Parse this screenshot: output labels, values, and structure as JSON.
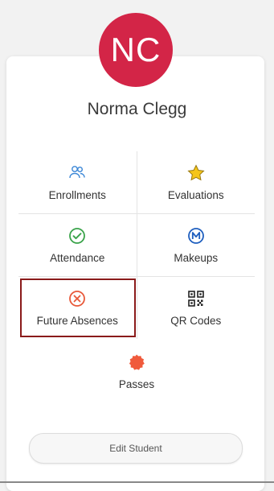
{
  "profile": {
    "initials": "NC",
    "name": "Norma Clegg",
    "avatar_color": "#d32547"
  },
  "menu": {
    "enrollments": "Enrollments",
    "evaluations": "Evaluations",
    "attendance": "Attendance",
    "makeups": "Makeups",
    "future_absences": "Future Absences",
    "qr_codes": "QR Codes",
    "passes": "Passes"
  },
  "icons": {
    "enrollments": "people-icon",
    "evaluations": "star-icon",
    "attendance": "check-circle-icon",
    "makeups": "makeup-m-icon",
    "future_absences": "x-circle-icon",
    "qr_codes": "qr-code-icon",
    "passes": "pass-badge-icon"
  },
  "actions": {
    "edit_student": "Edit Student"
  }
}
